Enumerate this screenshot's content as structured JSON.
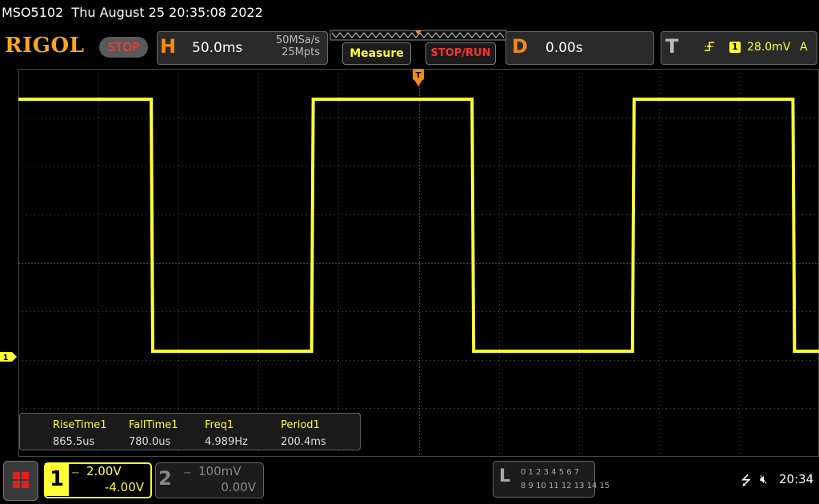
{
  "header": {
    "model": "MSO5102",
    "datetime": "Thu August 25 20:35:08 2022"
  },
  "toolbar": {
    "logo_text": "RIGOL",
    "run_state": "STOP",
    "horizontal_letter": "H",
    "timebase": "50.0ms",
    "sample_rate": "50MSa/s",
    "memory_depth": "25Mpts",
    "measure_label": "Measure",
    "stoprun_label": "STOP/RUN",
    "delay_letter": "D",
    "delay_value": "0.00s",
    "trigger_letter": "T",
    "trigger_edge_icon": "rising-edge-icon",
    "trigger_source": "1",
    "trigger_level": "28.0mV",
    "trigger_mode": "A"
  },
  "waveform": {
    "channel_marker": "1",
    "color": "#ffff33",
    "period_divisions": 4.008,
    "high_divisions": 2.0,
    "phase_fall_divisions": 2.8
  },
  "measurements": [
    {
      "label": "RiseTime1",
      "value": "865.5us"
    },
    {
      "label": "FallTime1",
      "value": "780.0us"
    },
    {
      "label": "Freq1",
      "value": "4.989Hz"
    },
    {
      "label": "Period1",
      "value": "200.4ms"
    }
  ],
  "bottom": {
    "ch1": {
      "number": "1",
      "coupling": "DC",
      "scale": "2.00V",
      "offset": "-4.00V"
    },
    "ch2": {
      "number": "2",
      "coupling": "DC",
      "scale": "100mV",
      "offset": "0.00V"
    },
    "la": {
      "letter": "L",
      "row1": "0 1 2 3  4 5 6 7",
      "row2": "8 9 10 11 12 13 14 15"
    },
    "clock": "20:34"
  },
  "colors": {
    "accent": "#f08a1a",
    "channel1": "#ffff33",
    "stop": "#ff3030",
    "grid": "#4a4a4a"
  }
}
